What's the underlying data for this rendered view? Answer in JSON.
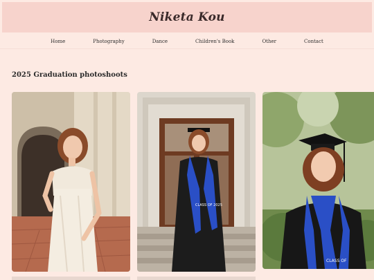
{
  "site": {
    "title": "Niketa Kou"
  },
  "nav": {
    "items": [
      {
        "label": "Home"
      },
      {
        "label": "Photography"
      },
      {
        "label": "Dance"
      },
      {
        "label": "Children's Book"
      },
      {
        "label": "Other"
      },
      {
        "label": "Contact"
      }
    ]
  },
  "section": {
    "title": "2025 Graduation photoshoots"
  },
  "gallery": {
    "photos": [
      {
        "subject": "woman in white one-shoulder dress under arched walkway"
      },
      {
        "subject": "graduate in black gown and blue stole in front of wooden doors",
        "stole_text": "CLASS OF 2025"
      },
      {
        "subject": "graduate in cap and gown with blue stole in garden",
        "stole_text": "CLASS OF"
      }
    ]
  },
  "colors": {
    "page_bg": "#fdeae3",
    "banner_bg": "#f7d3cc",
    "stole_blue": "#2a4fc6"
  }
}
